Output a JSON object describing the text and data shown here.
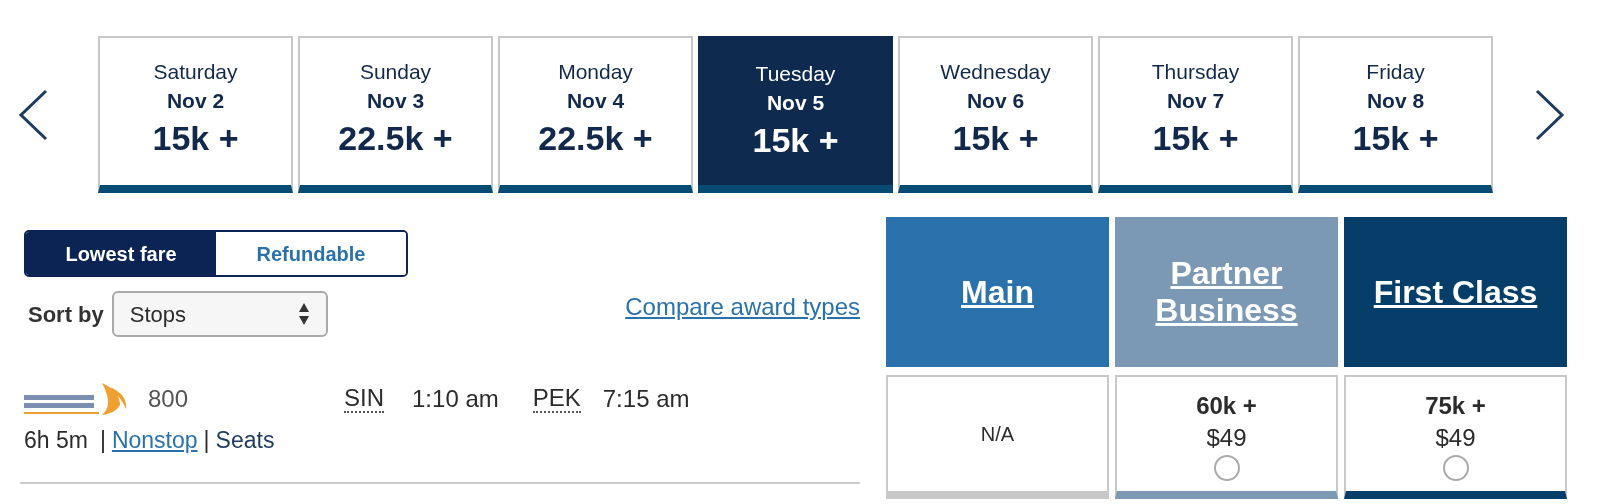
{
  "dates": [
    {
      "day": "Saturday",
      "date": "Nov 2",
      "price": "15k +",
      "selected": false
    },
    {
      "day": "Sunday",
      "date": "Nov 3",
      "price": "22.5k +",
      "selected": false
    },
    {
      "day": "Monday",
      "date": "Nov 4",
      "price": "22.5k +",
      "selected": false
    },
    {
      "day": "Tuesday",
      "date": "Nov 5",
      "price": "15k +",
      "selected": true
    },
    {
      "day": "Wednesday",
      "date": "Nov 6",
      "price": "15k +",
      "selected": false
    },
    {
      "day": "Thursday",
      "date": "Nov 7",
      "price": "15k +",
      "selected": false
    },
    {
      "day": "Friday",
      "date": "Nov 8",
      "price": "15k +",
      "selected": false
    }
  ],
  "fare_toggle": [
    {
      "label": "Lowest fare",
      "selected": true
    },
    {
      "label": "Refundable",
      "selected": false
    }
  ],
  "sort": {
    "label": "Sort by",
    "value": "Stops"
  },
  "compare_link": "Compare award types",
  "flight": {
    "number": "800",
    "origin": "SIN",
    "depart": "1:10 am",
    "destination": "PEK",
    "arrive": "7:15 am",
    "duration": "6h 5m",
    "separator_1": "|",
    "stops": "Nonstop",
    "separator_2": "|",
    "seats": "Seats"
  },
  "fare_classes": [
    {
      "name": "Main",
      "color": "#2a72ab",
      "available": false,
      "text": "N/A"
    },
    {
      "name": "Partner Business",
      "color": "#7b98b4",
      "available": true,
      "miles": "60k +",
      "price": "$49",
      "selected": false
    },
    {
      "name": "First Class",
      "color": "#043e69",
      "available": true,
      "miles": "75k +",
      "price": "$49",
      "selected": false
    }
  ]
}
